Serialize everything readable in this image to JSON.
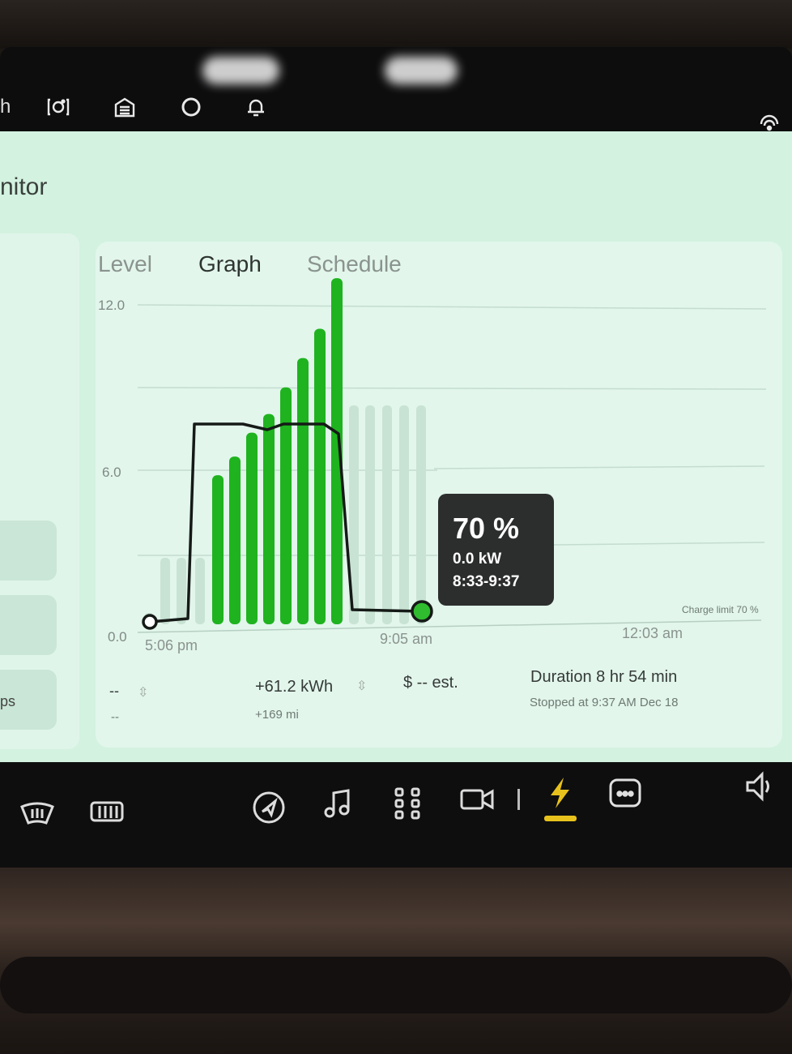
{
  "topbar": {
    "cut_label": "h",
    "icons": [
      "camera-icon",
      "garage-icon",
      "circle-icon",
      "bell-icon",
      "wifi-icon"
    ]
  },
  "page": {
    "title": "nitor"
  },
  "left_panel": {
    "bottom_item_label": "ps"
  },
  "tabs": [
    {
      "label": "Level",
      "active": false
    },
    {
      "label": "Graph",
      "active": true
    },
    {
      "label": "Schedule",
      "active": false
    }
  ],
  "chart_data": {
    "type": "bar",
    "y_ticks": [
      "12.0",
      "6.0",
      "0.0"
    ],
    "ylim": [
      0,
      12
    ],
    "x_ticks": [
      "5:06 pm",
      "9:05 am",
      "12:03 am"
    ],
    "bars_active": [
      5.6,
      6.3,
      7.2,
      7.9,
      8.9,
      10.0,
      11.1,
      13.0
    ],
    "bars_inactive_count": 5,
    "charge_limit_label": "Charge limit 70 %",
    "colors": {
      "bar": "#1fb31f",
      "bar_inactive": "#c8e3d3",
      "line": "#151a17",
      "marker": "#2fbd2f"
    }
  },
  "tooltip": {
    "percent": "70 %",
    "power": "0.0 kW",
    "time_range": "8:33-9:37"
  },
  "stats": {
    "left_value": "--",
    "left_sub": "--",
    "energy": "+61.2 kWh",
    "miles": "+169 mi",
    "cost": "$ -- est.",
    "duration": "Duration 8 hr 54 min",
    "stopped": "Stopped at 9:37 AM Dec 18"
  },
  "dock": {
    "icons": [
      "defrost-front-icon",
      "defrost-rear-icon",
      "navigation-icon",
      "music-icon",
      "apps-icon",
      "camera-icon",
      "charging-icon",
      "toybox-icon",
      "volume-icon"
    ],
    "active": "charging-icon",
    "accent": "#e8c21c"
  }
}
